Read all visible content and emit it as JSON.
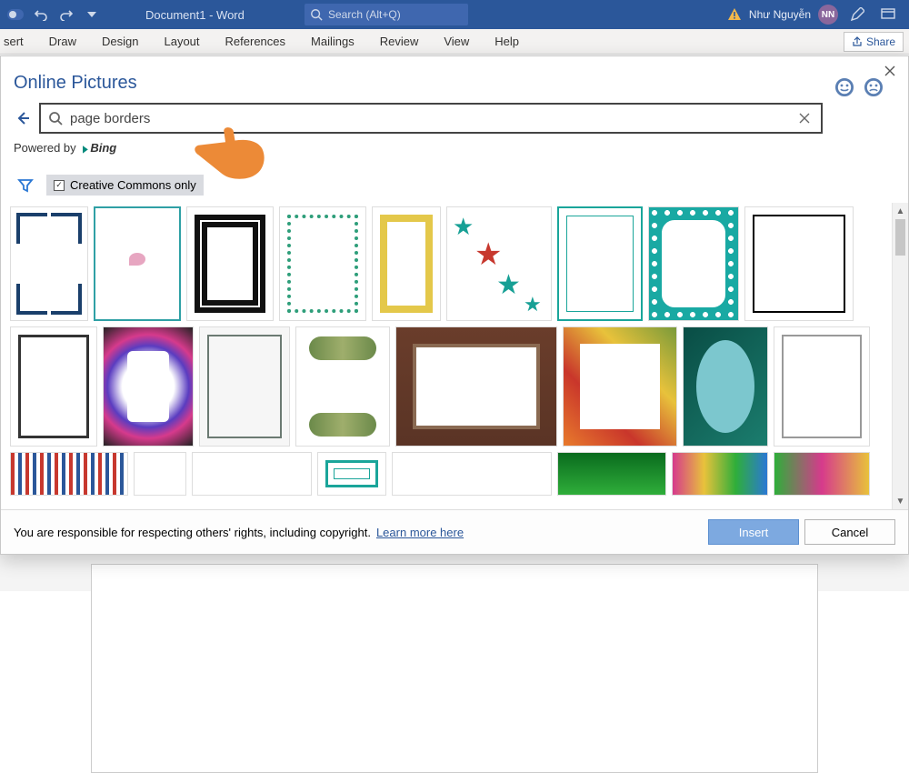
{
  "titlebar": {
    "doc_title": "Document1 - Word",
    "search_placeholder": "Search (Alt+Q)",
    "username": "Như Nguyễn",
    "avatar_initials": "NN"
  },
  "ribbon": {
    "tabs": [
      "sert",
      "Draw",
      "Design",
      "Layout",
      "References",
      "Mailings",
      "Review",
      "View",
      "Help"
    ],
    "share_label": "Share"
  },
  "panel": {
    "title": "Online Pictures",
    "search_value": "page borders",
    "powered_prefix": "Powered by",
    "powered_brand": "Bing",
    "cc_label": "Creative Commons only",
    "footer_notice": "You are responsible for respecting others' rights, including copyright.",
    "learn_more": "Learn more here",
    "insert_label": "Insert",
    "cancel_label": "Cancel"
  }
}
